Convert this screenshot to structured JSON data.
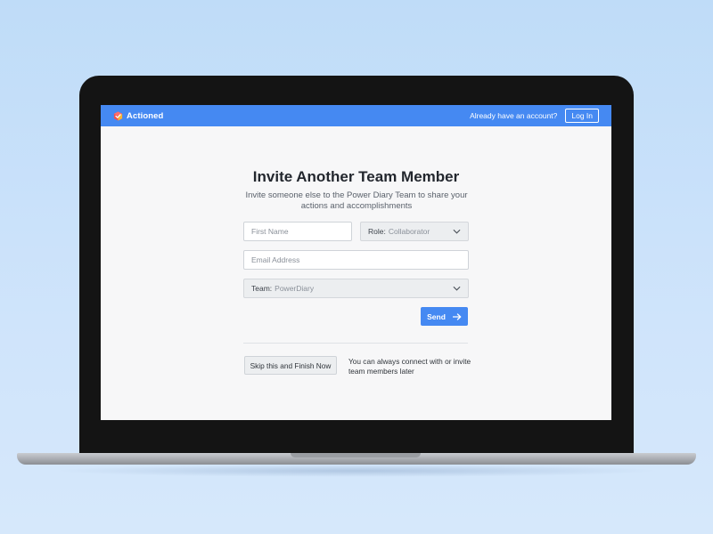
{
  "header": {
    "brand_name": "Actioned",
    "account_prompt": "Already have an account?",
    "login_label": "Log In"
  },
  "main": {
    "title": "Invite Another Team Member",
    "subtitle": "Invite someone else to the Power Diary Team to share your actions and accomplishments"
  },
  "form": {
    "first_name_placeholder": "First Name",
    "role_label": "Role:",
    "role_value": "Collaborator",
    "email_placeholder": "Email Address",
    "team_label": "Team:",
    "team_value": "PowerDiary",
    "send_label": "Send"
  },
  "footer": {
    "skip_label": "Skip this and Finish Now",
    "hint": "You can always connect with or invite team members later"
  },
  "colors": {
    "accent": "#4589f2",
    "background": "#bfdcf8"
  },
  "icons": [
    "logo-icon",
    "chevron-down-icon",
    "arrow-right-icon"
  ]
}
